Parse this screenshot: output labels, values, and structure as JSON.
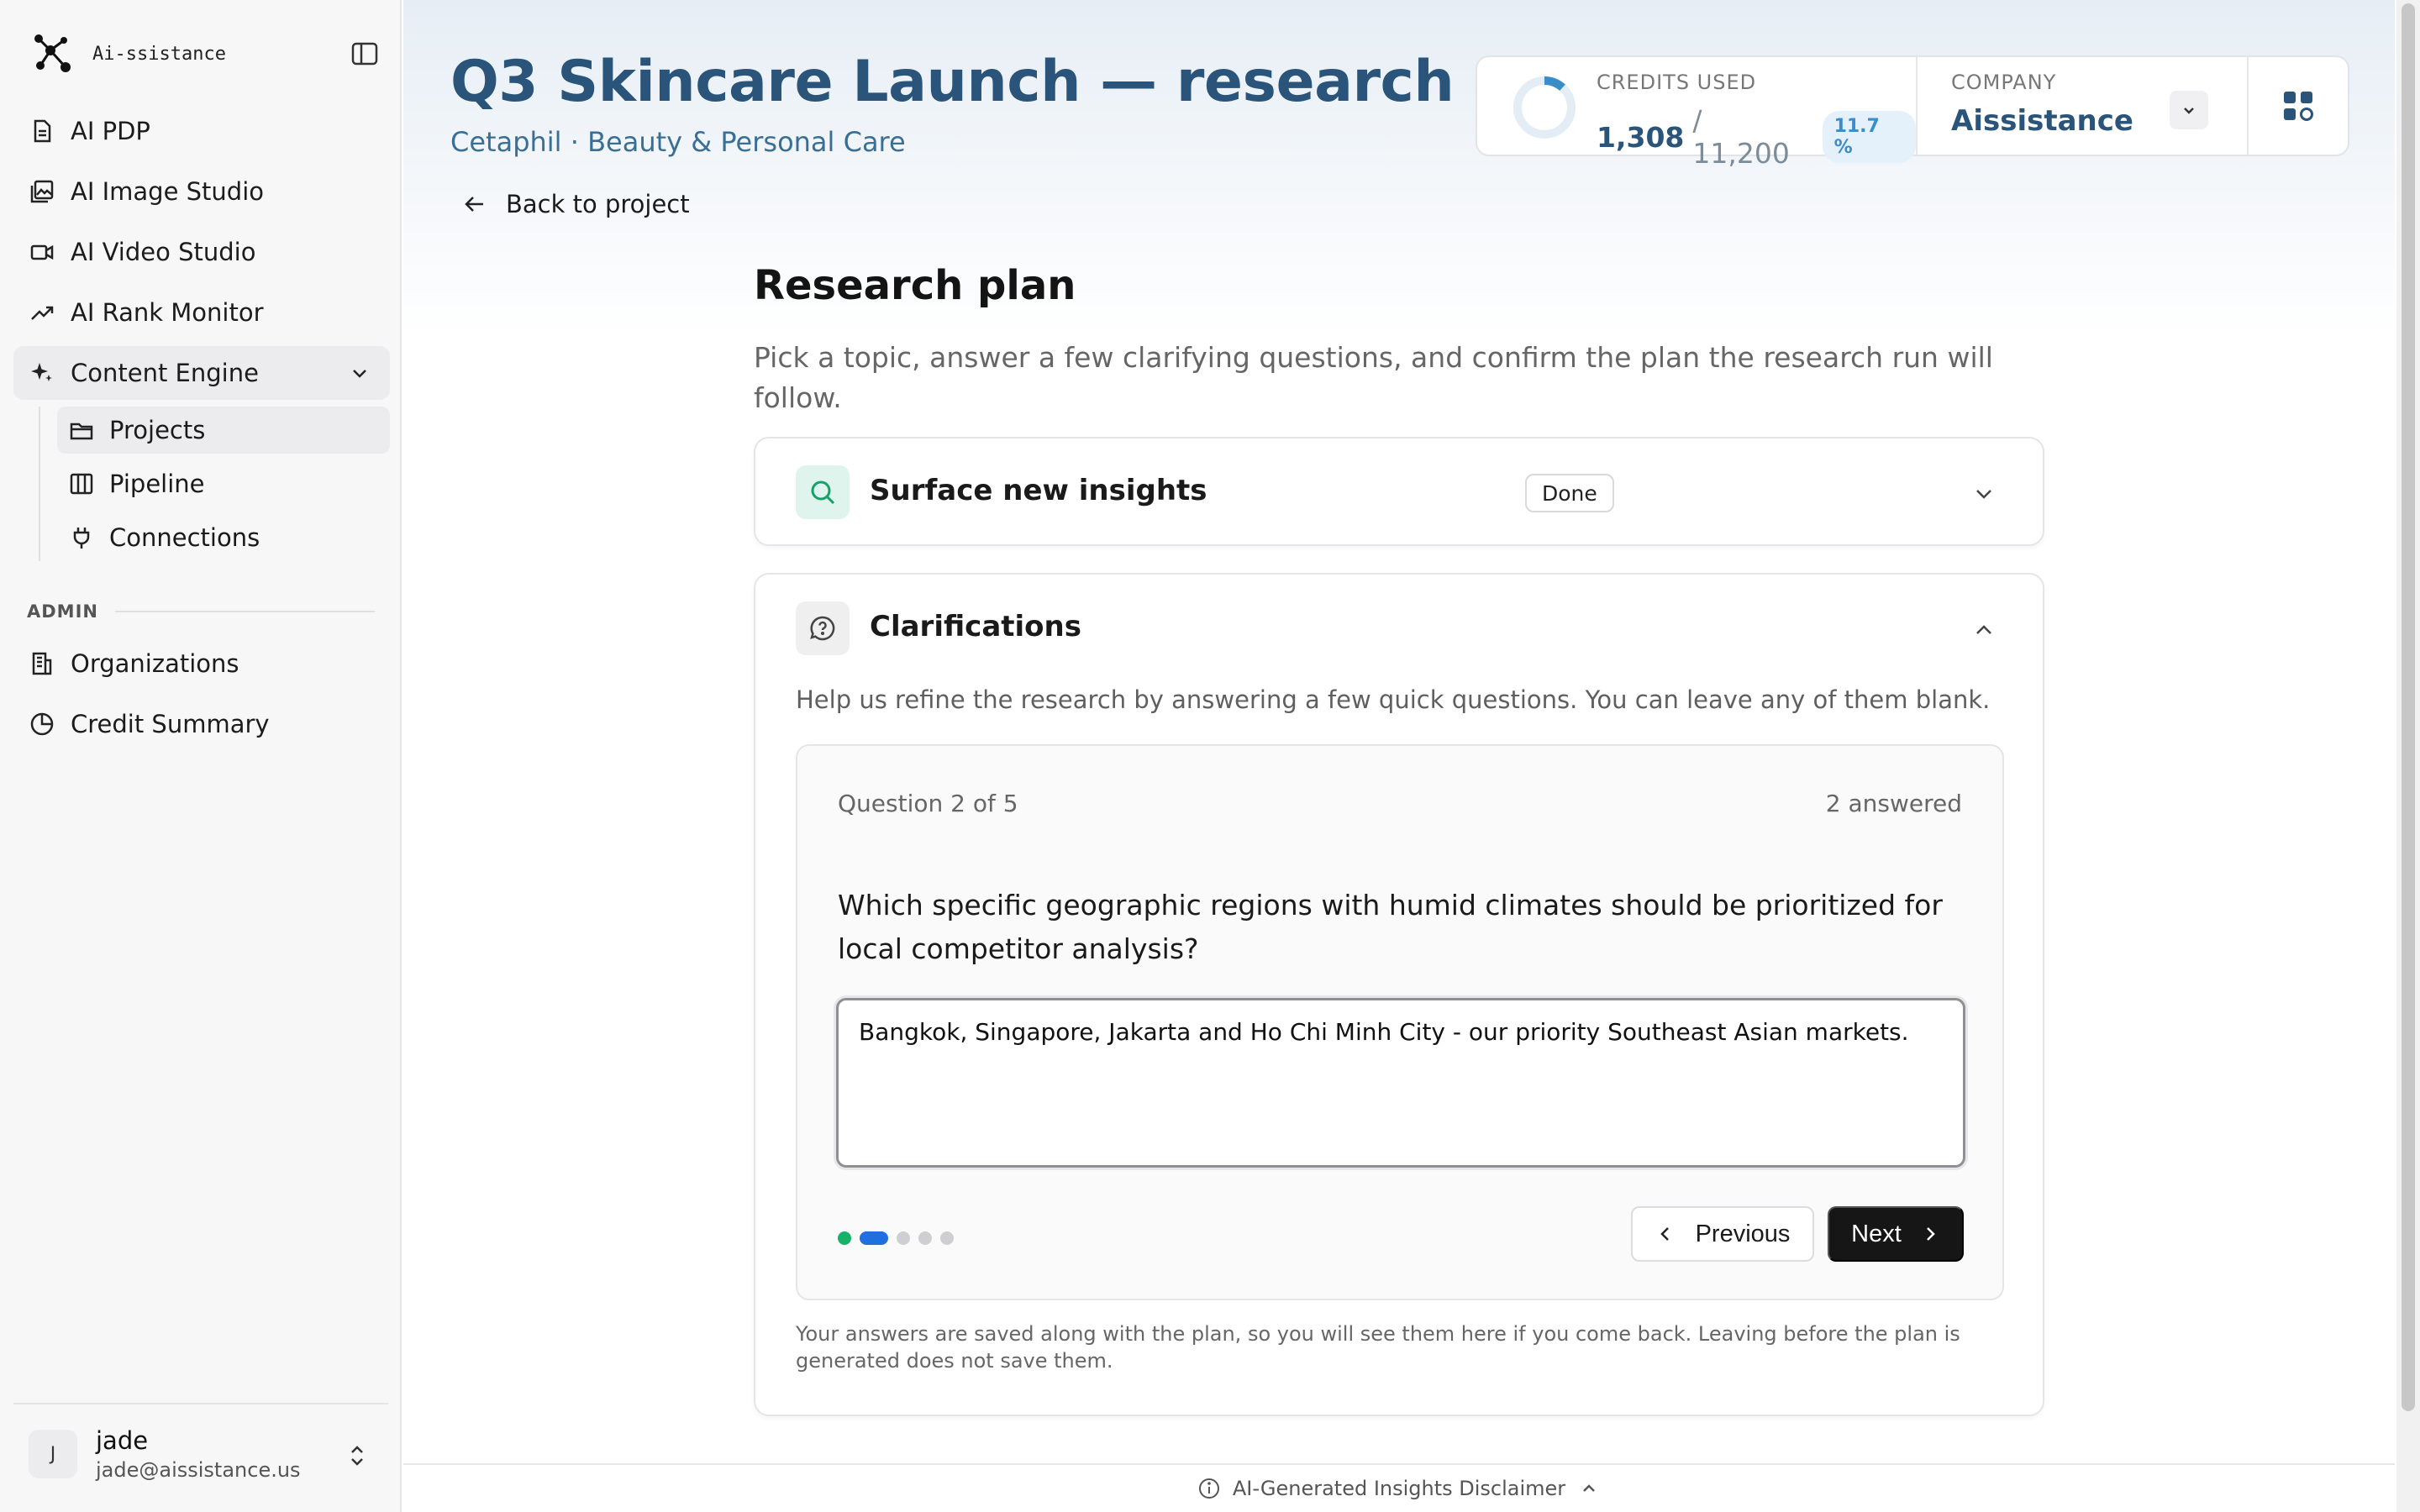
{
  "brand": {
    "name": "Ai-ssistance",
    "logo_icon": "molecule-icon"
  },
  "sidebar": {
    "items": [
      {
        "label": "AI PDP",
        "icon": "document-icon"
      },
      {
        "label": "AI Image Studio",
        "icon": "image-icon"
      },
      {
        "label": "AI Video Studio",
        "icon": "video-icon"
      },
      {
        "label": "AI Rank Monitor",
        "icon": "trend-icon"
      },
      {
        "label": "Content Engine",
        "icon": "sparkle-icon"
      }
    ],
    "sub_items": [
      {
        "label": "Projects",
        "icon": "folder-icon"
      },
      {
        "label": "Pipeline",
        "icon": "columns-icon"
      },
      {
        "label": "Connections",
        "icon": "plug-icon"
      }
    ],
    "admin_heading": "ADMIN",
    "admin_items": [
      {
        "label": "Organizations",
        "icon": "building-icon"
      },
      {
        "label": "Credit Summary",
        "icon": "pie-icon"
      }
    ],
    "user": {
      "initial": "J",
      "name": "jade",
      "email": "jade@aissistance.us"
    }
  },
  "header": {
    "title": "Q3 Skincare Launch — research",
    "subtitle": "Cetaphil · Beauty & Personal Care",
    "back_label": "Back to project"
  },
  "credits": {
    "label": "CREDITS USED",
    "used": "1,308",
    "total": "/ 11,200",
    "percent": "11.7 %",
    "percent_value": 11.7,
    "accent": "#3a8dc9"
  },
  "company": {
    "label": "COMPANY",
    "name": "Aissistance"
  },
  "research": {
    "title": "Research plan",
    "description": "Pick a topic, answer a few clarifying questions, and confirm the plan the research run will follow."
  },
  "topic_card": {
    "title": "Surface new insights",
    "badge": "Done"
  },
  "clarifications": {
    "title": "Clarifications",
    "description": "Help us refine the research by answering a few quick questions. You can leave any of them blank.",
    "question_count": "Question 2 of 5",
    "answered": "2 answered",
    "question": "Which specific geographic regions with humid climates should be prioritized for local competitor analysis?",
    "answer": "Bangkok, Singapore, Jakarta and Ho Chi Minh City - our priority Southeast Asian markets.",
    "previous_label": "Previous",
    "next_label": "Next",
    "save_note": "Your answers are saved along with the plan, so you will see them here if you come back. Leaving before the plan is generated does not save them."
  },
  "footer": {
    "disclaimer": "AI-Generated Insights Disclaimer"
  },
  "colors": {
    "title": "#2a5479",
    "done_dot": "#17b26a",
    "active_dot": "#1f6fde",
    "next_button": "#161616"
  }
}
